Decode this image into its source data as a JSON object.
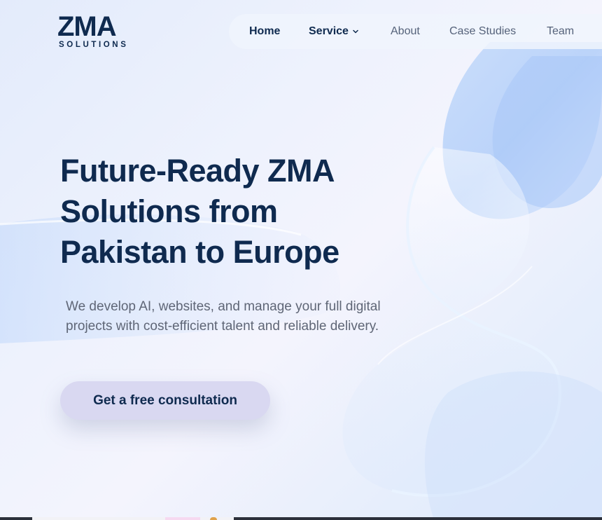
{
  "logo": {
    "wordmark": "ZMA",
    "tagline": "SOLUTIONS"
  },
  "nav": {
    "items": [
      {
        "label": "Home",
        "active": true
      },
      {
        "label": "Service",
        "has_dropdown": true
      },
      {
        "label": "About"
      },
      {
        "label": "Case Studies"
      },
      {
        "label": "Team"
      }
    ]
  },
  "hero": {
    "title": "Future-Ready ZMA Solutions from Pakistan to Europe",
    "description": "We develop AI, websites, and manage your full digital projects with cost-efficient talent and reliable delivery.",
    "cta_label": "Get a free consultation"
  },
  "colors": {
    "brand_navy": "#0f2a4f",
    "cta_background": "#d9d8f1",
    "body_text": "#5f6676"
  },
  "icons": {
    "dropdown": "chevron-down-icon"
  }
}
